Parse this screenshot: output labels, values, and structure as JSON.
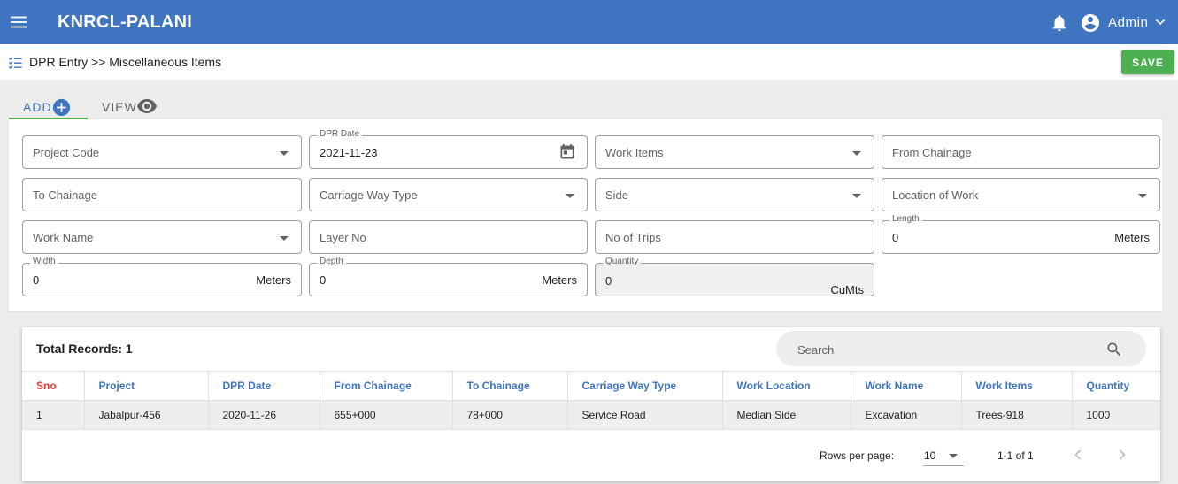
{
  "header": {
    "app_title": "KNRCL-PALANI",
    "user_name": "Admin"
  },
  "breadcrumb": "DPR Entry >> Miscellaneous Items",
  "toolbar": {
    "save_label": "SAVE"
  },
  "tabs": [
    {
      "label": "ADD"
    },
    {
      "label": "VIEW"
    }
  ],
  "form": {
    "project_code": {
      "placeholder": "Project Code"
    },
    "dpr_date": {
      "label": "DPR Date",
      "value": "2021-11-23"
    },
    "work_items": {
      "placeholder": "Work Items"
    },
    "from_chainage": {
      "placeholder": "From Chainage"
    },
    "to_chainage": {
      "placeholder": "To Chainage"
    },
    "carriage_way_type": {
      "placeholder": "Carriage Way Type"
    },
    "side": {
      "placeholder": "Side"
    },
    "location_of_work": {
      "placeholder": "Location of Work"
    },
    "work_name": {
      "placeholder": "Work Name"
    },
    "layer_no": {
      "placeholder": "Layer No"
    },
    "no_of_trips": {
      "placeholder": "No of Trips"
    },
    "length": {
      "label": "Length",
      "value": "0",
      "unit": "Meters"
    },
    "width": {
      "label": "Width",
      "value": "0",
      "unit": "Meters"
    },
    "depth": {
      "label": "Depth",
      "value": "0",
      "unit": "Meters"
    },
    "quantity": {
      "label": "Quantity",
      "value": "0",
      "unit": "CuMts"
    }
  },
  "table": {
    "total_records": "Total Records: 1",
    "search_placeholder": "Search",
    "columns": [
      "Sno",
      "Project",
      "DPR Date",
      "From Chainage",
      "To Chainage",
      "Carriage Way Type",
      "Work Location",
      "Work Name",
      "Work Items",
      "Quantity"
    ],
    "rows": [
      [
        "1",
        "Jabalpur-456",
        "2020-11-26",
        "655+000",
        "78+000",
        "Service Road",
        "Median Side",
        "Excavation",
        "Trees-918",
        "1000"
      ]
    ],
    "pagination": {
      "rows_per_page_label": "Rows per page:",
      "rows_per_page": "10",
      "range": "1-1 of 1"
    }
  },
  "colors": {
    "header": "#3e74c0",
    "save": "#4caf50",
    "sno_header": "#e53935"
  },
  "icons": [
    "menu-icon",
    "bell-icon",
    "account-circle-icon",
    "chevron-down-icon",
    "list-check-icon",
    "add-circle-icon",
    "eye-icon",
    "calendar-icon",
    "search-icon",
    "chevron-left-icon",
    "chevron-right-icon"
  ]
}
